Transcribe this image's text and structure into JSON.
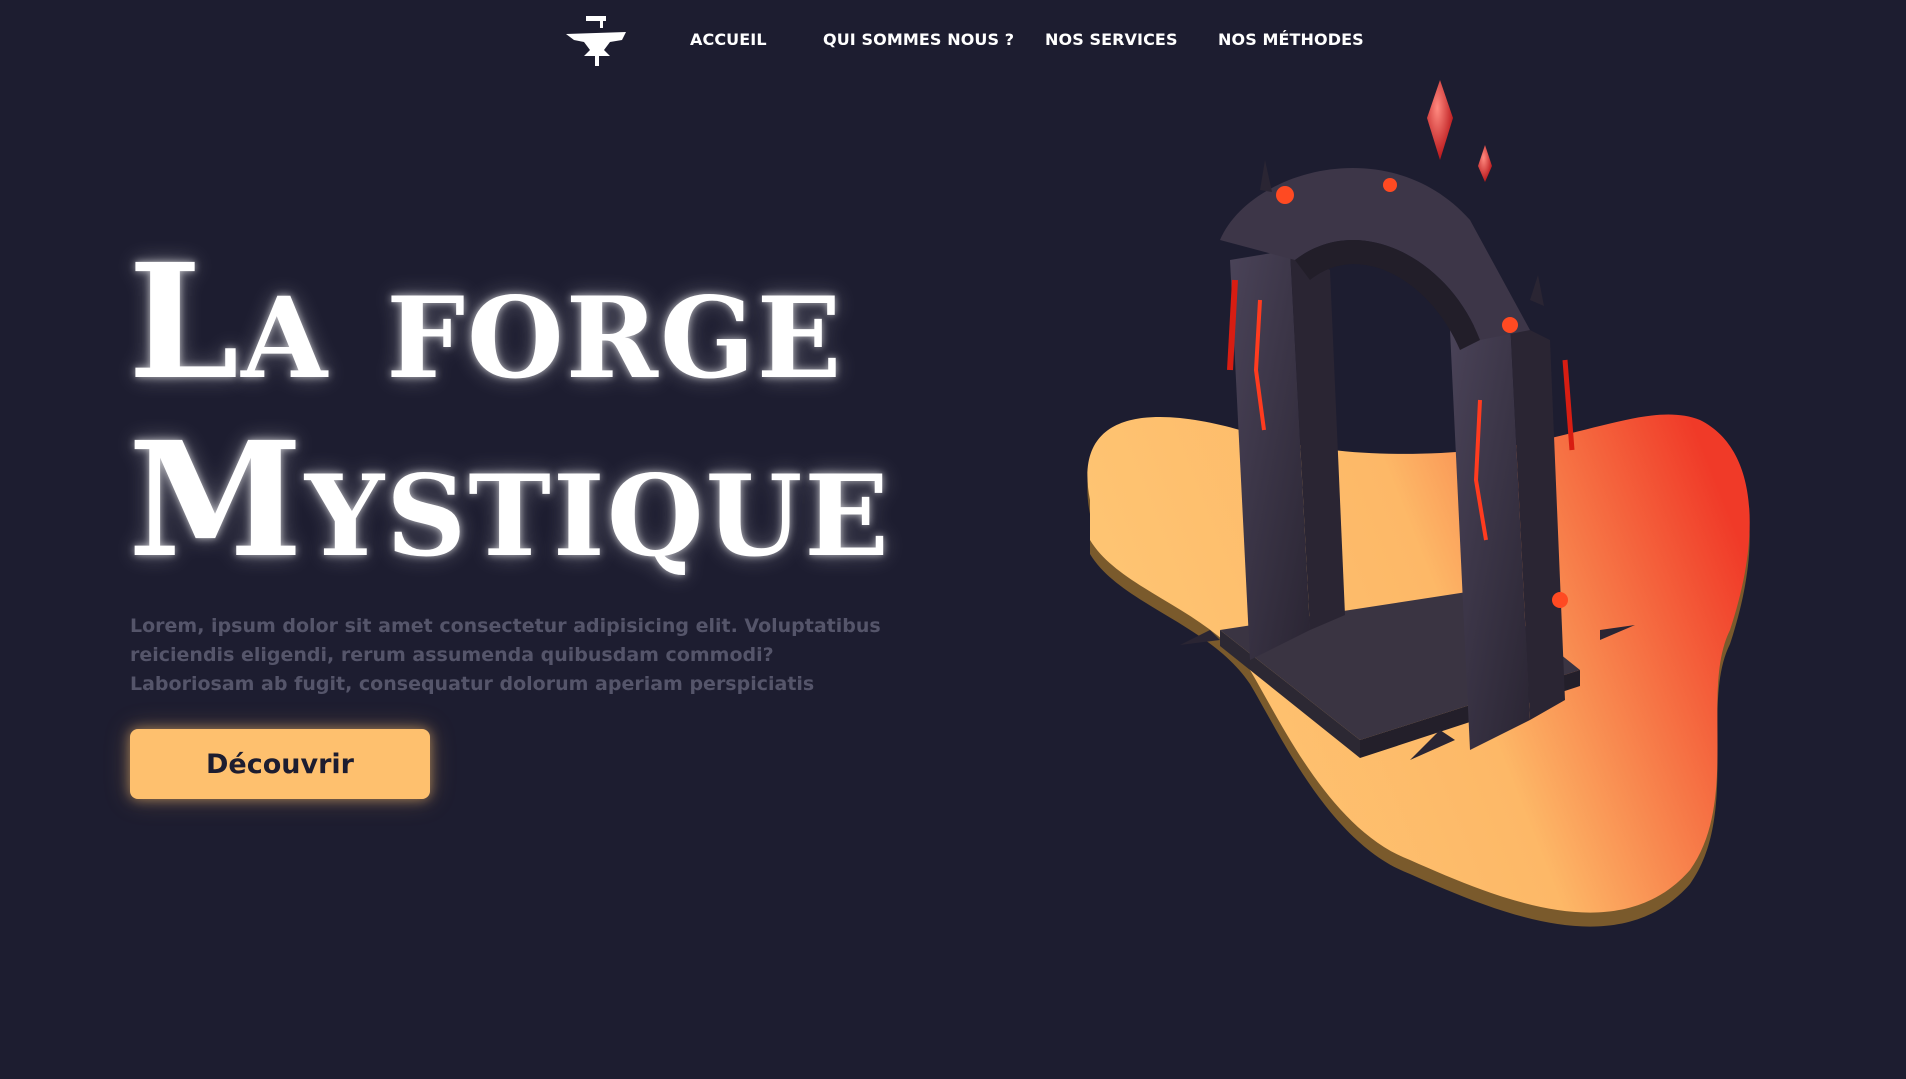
{
  "nav": {
    "logo_icon": "anvil-hammer-icon",
    "links": [
      {
        "label": "ACCUEIL"
      },
      {
        "label": "QUI SOMMES NOUS ?"
      },
      {
        "label": "NOS SERVICES"
      },
      {
        "label": "NOS MÉTHODES"
      }
    ]
  },
  "hero": {
    "title_line1": "La forge",
    "title_line2": "Mystique",
    "description": "Lorem, ipsum dolor sit amet consectetur adipisicing elit. Voluptatibus reiciendis eligendi, rerum assumenda quibusdam commodi? Laboriosam ab fugit, consequatur dolorum aperiam perspiciatis",
    "cta_label": "Découvrir",
    "illustration_icon": "dark-portal-arch-illustration"
  },
  "colors": {
    "background": "#1d1d30",
    "accent": "#fec06e",
    "gradient_end": "#f03a28",
    "text": "#ffffff",
    "muted_text": "#55556a"
  }
}
